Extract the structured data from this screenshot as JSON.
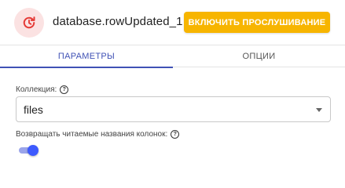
{
  "header": {
    "icon": "refresh-clock-icon",
    "icon_color": "#e53935",
    "icon_bg": "#fbe2e2",
    "node_name": "database.rowUpdated_1",
    "listen_button_label": "ВКЛЮЧИТЬ ПРОСЛУШИВАНИЕ",
    "listen_button_color": "#f7b500"
  },
  "tabs": [
    {
      "label": "ПАРАМЕТРЫ",
      "active": true
    },
    {
      "label": "ОПЦИИ",
      "active": false
    }
  ],
  "accent_color": "#3f51b5",
  "form": {
    "collection": {
      "label": "Коллекция:",
      "help_icon": "?",
      "value": "files"
    },
    "readable_columns": {
      "label": "Возвращать читаемые названия колонок:",
      "help_icon": "?",
      "enabled": true
    }
  }
}
